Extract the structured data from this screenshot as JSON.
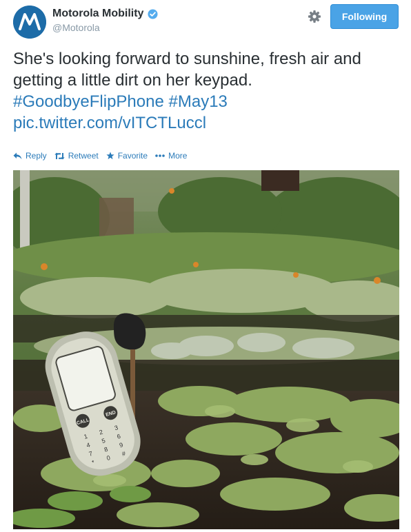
{
  "account": {
    "name": "Motorola Mobility",
    "handle": "@Motorola",
    "avatar_icon": "motorola-logo-icon",
    "verified_icon": "verified-badge-icon",
    "avatar_color": "#1d6ca8"
  },
  "header": {
    "settings_icon": "gear-icon",
    "follow_label": "Following",
    "follow_color": "#4aa3e6"
  },
  "tweet": {
    "text": "She's looking forward to sunshine, fresh air and getting a little dirt on her keypad.",
    "hashtags": [
      "#GoodbyeFlipPhone",
      "#May13"
    ],
    "link": "pic.twitter.com/vITCTLuccl",
    "link_color": "#2b7bb9"
  },
  "actions": [
    {
      "label": "Reply",
      "icon": "reply-icon"
    },
    {
      "label": "Retweet",
      "icon": "retweet-icon"
    },
    {
      "label": "Favorite",
      "icon": "star-icon"
    },
    {
      "label": "More",
      "icon": "more-dots-icon"
    }
  ],
  "photo": {
    "phone_keys": {
      "call": "CALL",
      "end": "END",
      "keypad": [
        "1",
        "2",
        "3",
        "4",
        "5",
        "6",
        "7",
        "8",
        "9",
        "*",
        "0",
        "#"
      ]
    }
  }
}
